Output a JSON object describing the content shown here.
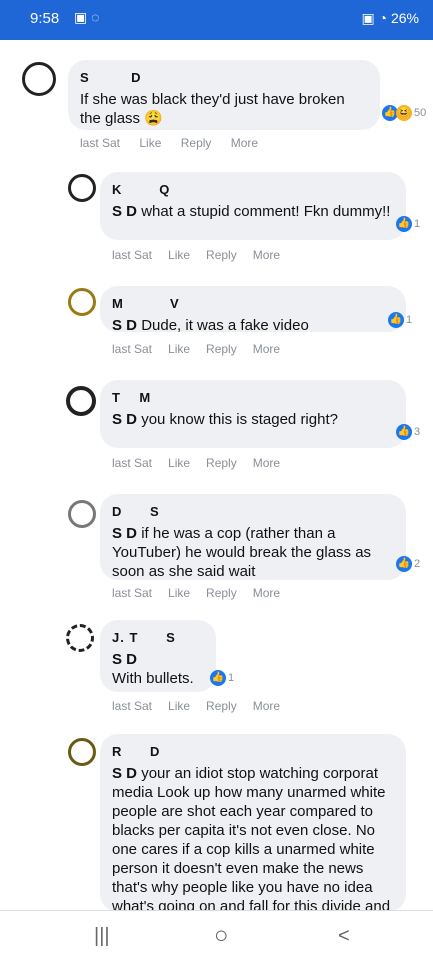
{
  "status": {
    "time": "9:58",
    "battery": "26%"
  },
  "comments": [
    {
      "name": "S         D",
      "text": "If she was black they'd just have broken the glass 😩",
      "meta": [
        "last Sat",
        "Like",
        "Reply",
        "More"
      ],
      "count": "50"
    },
    {
      "name": "K        Q",
      "mention": "S          D",
      "text": "what a stupid comment! Fkn dummy!!",
      "meta": [
        "last Sat",
        "Like",
        "Reply",
        "More"
      ],
      "count": "1"
    },
    {
      "name": "M          V",
      "mention": "S          D",
      "text": "Dude, it was a fake video",
      "meta": [
        "last Sat",
        "Like",
        "Reply",
        "More"
      ],
      "count": "1"
    },
    {
      "name": "T    M",
      "mention": "S          D",
      "text": "you know this is staged right?",
      "meta": [
        "last Sat",
        "Like",
        "Reply",
        "More"
      ],
      "count": "3"
    },
    {
      "name": "D      S",
      "mention": "S          D",
      "text": "if he was a cop (rather than a YouTuber) he would break the glass as soon as she said wait",
      "meta": [
        "last Sat",
        "Like",
        "Reply",
        "More"
      ],
      "count": "2"
    },
    {
      "name": "J. T      S",
      "mention": "S          D",
      "text": "With bullets.",
      "meta": [
        "last Sat",
        "Like",
        "Reply",
        "More"
      ],
      "count": "1"
    },
    {
      "name": "R      D",
      "mention": "S          D",
      "text": "your an idiot stop watching corporat media Look up how many unarmed white people are shot each year compared to blacks per capita it's not even close. No one cares if a cop kills a unarmed white person it doesn't even make the news that's why people like you have no idea what's going on and fall for this divide and",
      "meta": [],
      "count": ""
    }
  ],
  "nav": {
    "recent": "|||",
    "home": "○",
    "back": "<"
  }
}
